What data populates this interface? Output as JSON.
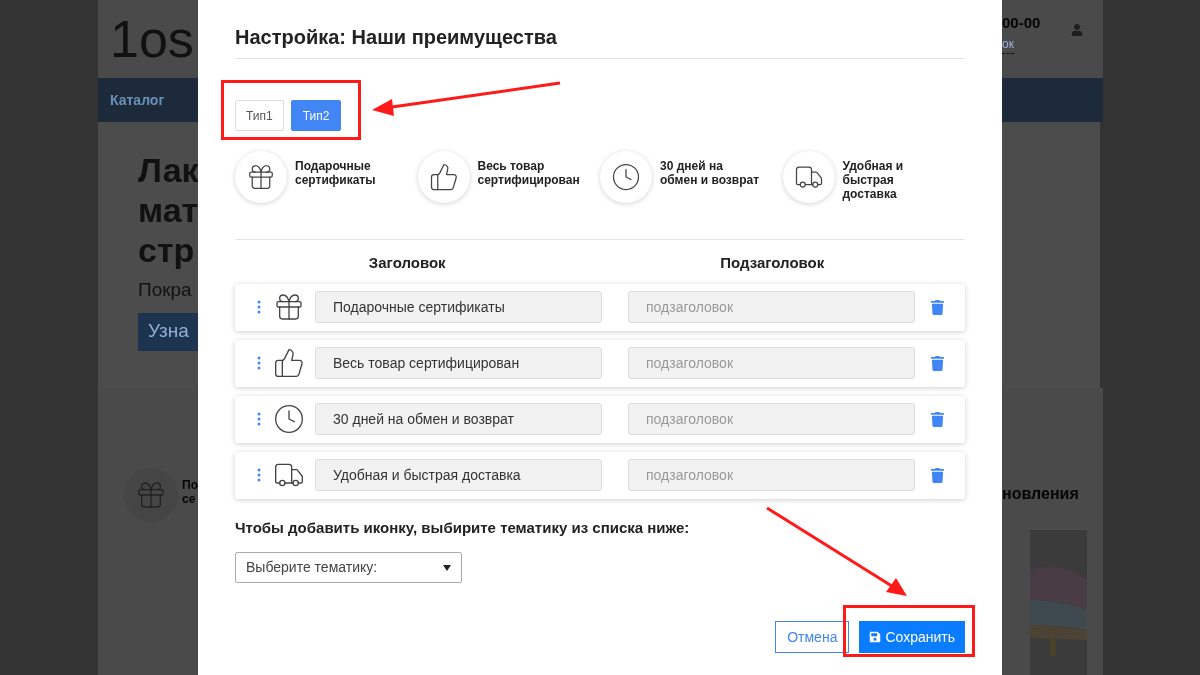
{
  "background_page": {
    "logo": "1os",
    "nav_item": "Каталог",
    "hero_lines": [
      "Лак",
      "мат",
      "стр"
    ],
    "hero_subtitle": "Покра",
    "hero_button": "Узна",
    "phone": "00-00",
    "link": "ок",
    "feature_lines": [
      "По",
      "се"
    ],
    "section_title": "новления"
  },
  "dialog": {
    "title": "Настройка: Наши преимущества",
    "tabs": [
      {
        "label": "Тип1",
        "selected": false
      },
      {
        "label": "Тип2",
        "selected": true
      }
    ],
    "preview": [
      {
        "kind": "gift",
        "title": "Подарочные сертификаты"
      },
      {
        "kind": "thumb",
        "title": "Весь товар сертифицирован"
      },
      {
        "kind": "clock",
        "title": "30 дней на обмен и возврат"
      },
      {
        "kind": "truck",
        "title": "Удобная и быстрая доставка"
      }
    ],
    "columns": [
      "Заголовок",
      "Подзаголовок"
    ],
    "rows": [
      {
        "kind": "gift",
        "title": "Подарочные сертификаты",
        "placeholder": "подзаголовок"
      },
      {
        "kind": "thumb",
        "title": "Весь товар сертифицирован",
        "placeholder": "подзаголовок"
      },
      {
        "kind": "clock",
        "title": "30 дней на обмен и возврат",
        "placeholder": "подзаголовок"
      },
      {
        "kind": "truck",
        "title": "Удобная и быстрая доставка",
        "placeholder": "подзаголовок"
      }
    ],
    "hint": "Чтобы добавить иконку, выбирите тематику из списка ниже:",
    "theme_select": {
      "value": "Выберите тематику:"
    },
    "buttons": {
      "cancel": "Отмена",
      "save": "Сохранить"
    }
  }
}
